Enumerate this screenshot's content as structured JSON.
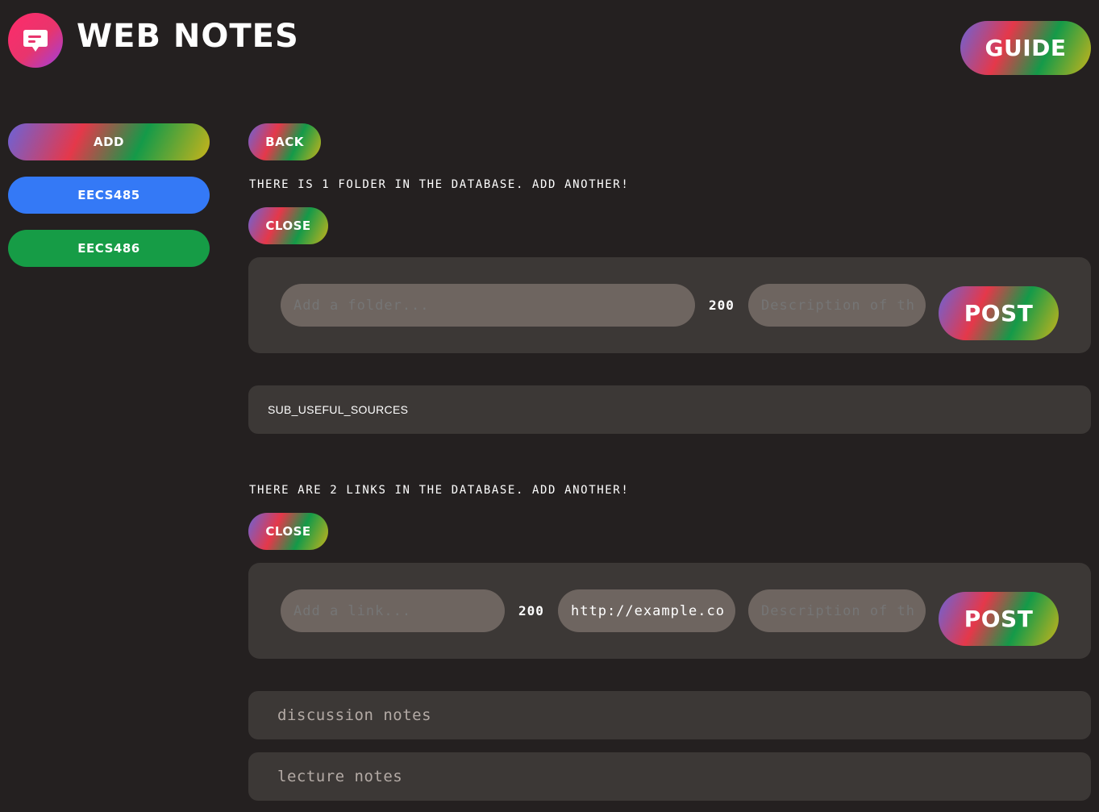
{
  "header": {
    "app_title": "WEB NOTES",
    "guide_label": "GUIDE",
    "logo_icon": "chat-bubble-icon"
  },
  "sidebar": {
    "add_label": "ADD",
    "items": [
      {
        "label": "EECS485",
        "color": "#3479f6"
      },
      {
        "label": "EECS486",
        "color": "#169c46"
      }
    ]
  },
  "main": {
    "back_label": "BACK",
    "folders": {
      "status": "THERE IS 1 FOLDER IN THE DATABASE. ADD ANOTHER!",
      "close_label": "CLOSE",
      "name_placeholder": "Add a folder...",
      "char_count": "200",
      "description_placeholder": "Description of th",
      "post_label": "POST",
      "items": [
        "SUB_USEFUL_SOURCES"
      ]
    },
    "links": {
      "status": "THERE ARE 2 LINKS IN THE DATABASE. ADD ANOTHER!",
      "close_label": "CLOSE",
      "name_placeholder": "Add a link...",
      "char_count": "200",
      "url_value": "http://example.co",
      "description_placeholder": "Description of th",
      "post_label": "POST",
      "items": [
        "discussion notes",
        "lecture notes"
      ]
    }
  },
  "colors": {
    "background": "#242020",
    "panel": "#3c3836",
    "input": "#6e6560"
  }
}
